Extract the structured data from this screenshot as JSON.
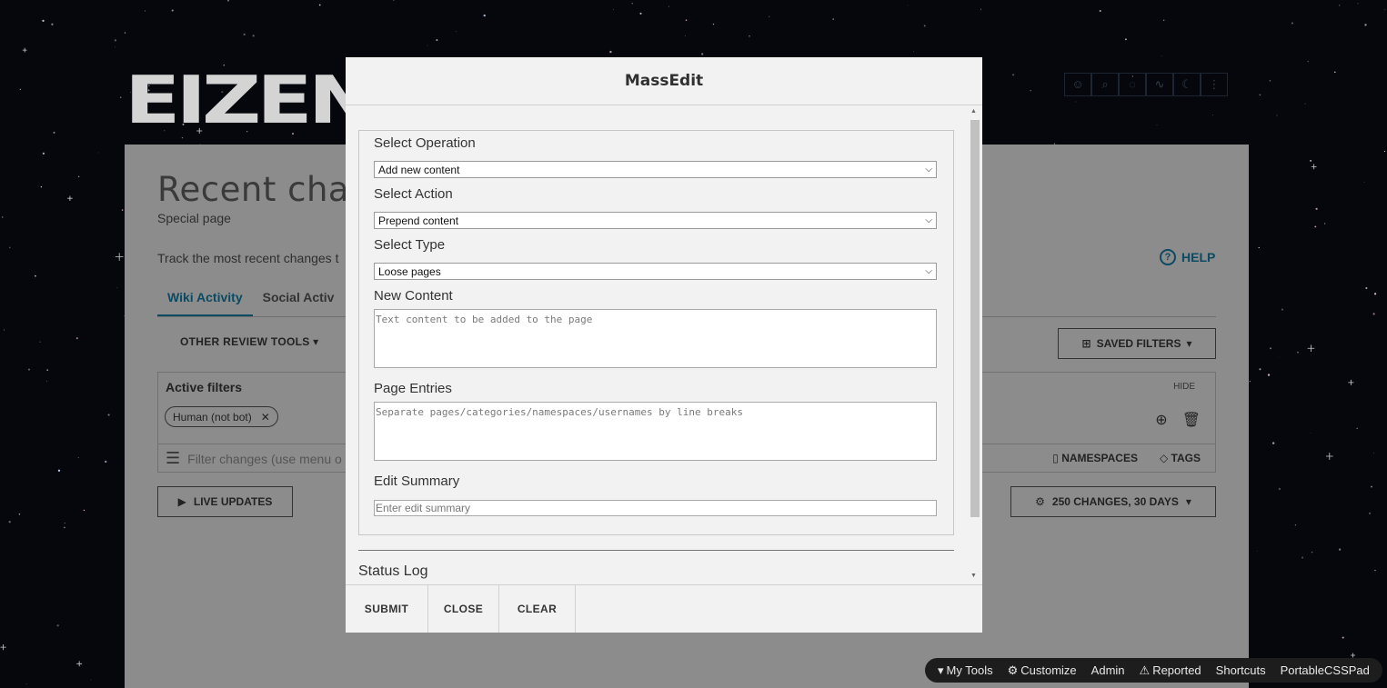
{
  "background": {
    "logo_text": "EIZEN",
    "page_title": "Recent chan",
    "page_subtitle": "Special page",
    "page_description": "Track the most recent changes t",
    "help_label": "HELP",
    "tabs": [
      {
        "label": "Wiki Activity"
      },
      {
        "label": "Social Activ"
      }
    ],
    "other_review_tools": "OTHER REVIEW TOOLS",
    "saved_filters": "SAVED FILTERS",
    "active_filters_label": "Active filters",
    "hide_label": "HIDE",
    "filter_chip": "Human (not bot)",
    "filter_placeholder": "Filter changes (use menu o",
    "namespaces_label": "NAMESPACES",
    "tags_label": "TAGS",
    "live_updates": "LIVE UPDATES",
    "changes_setting": "250 CHANGES, 30 DAYS"
  },
  "bottom_toolbar": {
    "items": [
      "My Tools",
      "Customize",
      "Admin",
      "Reported",
      "Shortcuts",
      "PortableCSSPad"
    ]
  },
  "modal": {
    "title": "MassEdit",
    "operation_label": "Select Operation",
    "operation_value": "Add new content",
    "action_label": "Select Action",
    "action_value": "Prepend content",
    "type_label": "Select Type",
    "type_value": "Loose pages",
    "content_label": "New Content",
    "content_placeholder": "Text content to be added to the page",
    "entries_label": "Page Entries",
    "entries_placeholder": "Separate pages/categories/namespaces/usernames by line breaks",
    "summary_label": "Edit Summary",
    "summary_placeholder": "Enter edit summary",
    "status_log_label": "Status Log",
    "buttons": {
      "submit": "SUBMIT",
      "close": "CLOSE",
      "clear": "CLEAR"
    }
  }
}
